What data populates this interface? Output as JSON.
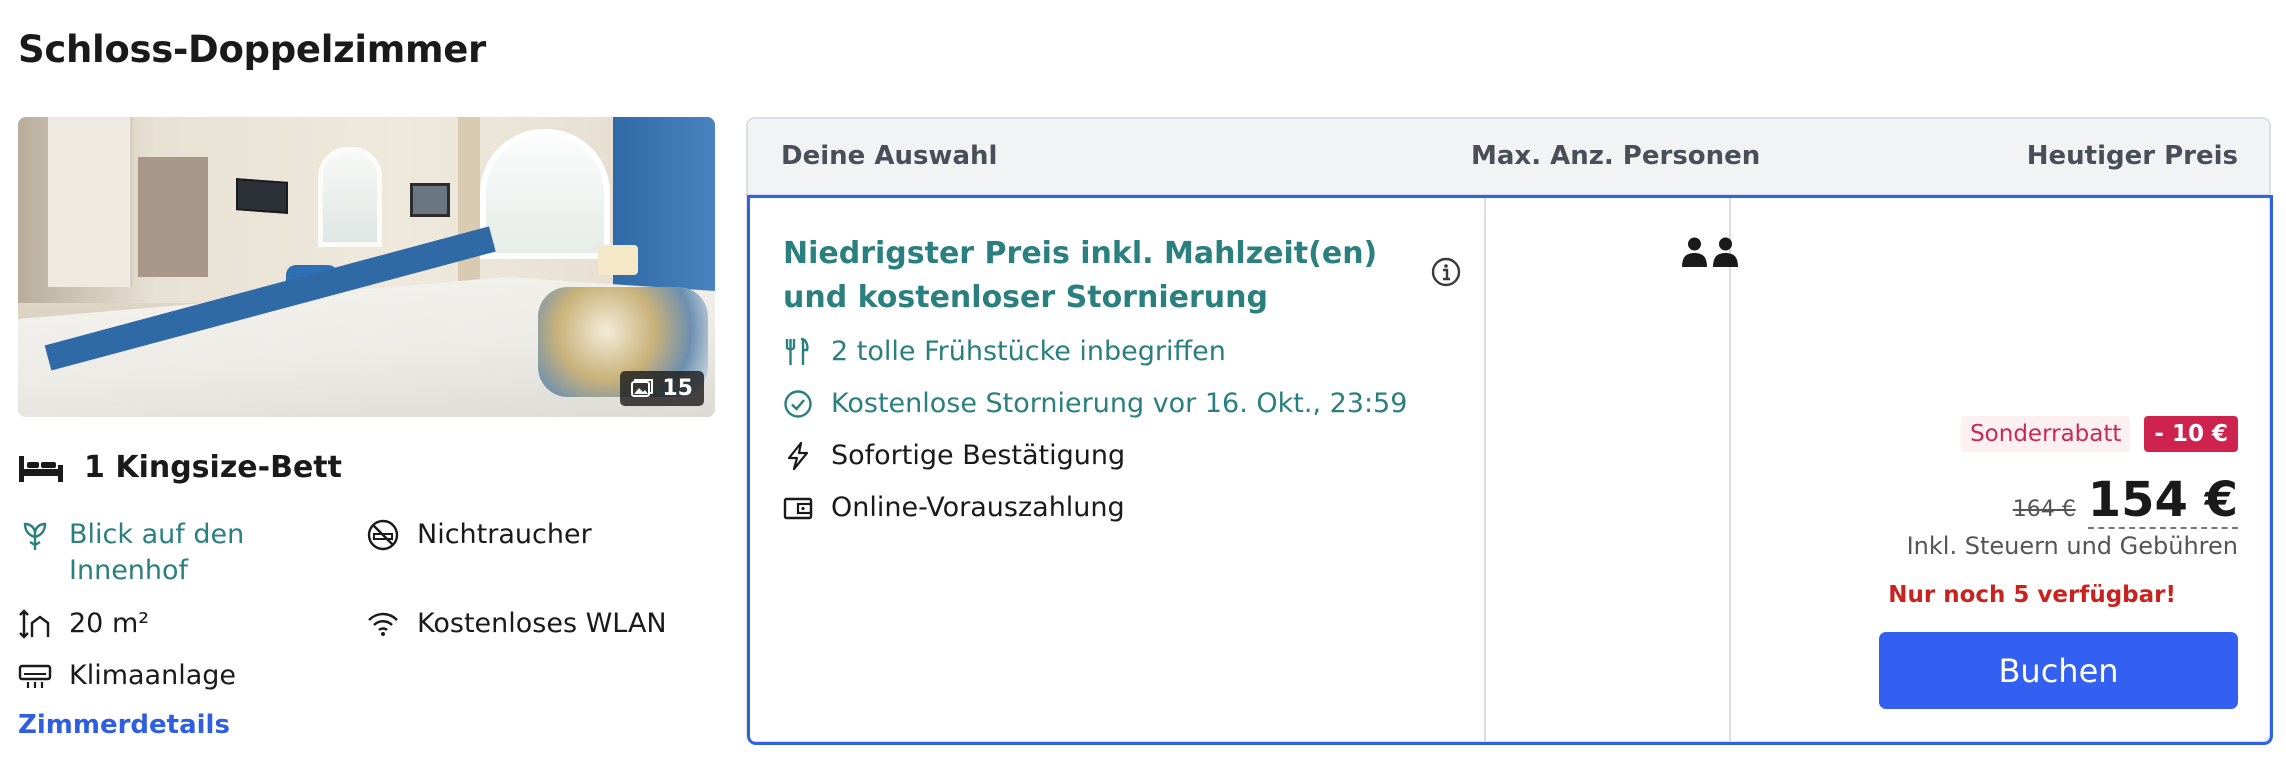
{
  "room": {
    "title": "Schloss-Doppelzimmer",
    "photo_count": "15",
    "bed": "1 Kingsize-Bett",
    "facilities": {
      "view": "Blick auf den Innenhof",
      "non_smoking": "Nichtraucher",
      "size": "20 m²",
      "wifi": "Kostenloses WLAN",
      "ac": "Klimaanlage"
    },
    "details_link": "Zimmerdetails"
  },
  "table": {
    "headers": {
      "selection": "Deine Auswahl",
      "persons": "Max. Anz. Personen",
      "price": "Heutiger Preis"
    },
    "offer": {
      "title": "Niedrigster Preis inkl. Mahlzeit(en) und kostenloser Stornierung",
      "conditions": {
        "breakfast": "2 tolle Frühstücke inbegriffen",
        "cancellation": "Kostenlose Stornierung vor 16. Okt., 23:59",
        "confirmation": "Sofortige Bestätigung",
        "payment": "Online-Vorauszahlung"
      },
      "max_persons": 2,
      "discount_label": "Sonderrabatt",
      "discount_value": "- 10 €",
      "old_price": "164 €",
      "price": "154 €",
      "tax_note": "Inkl. Steuern und Gebühren",
      "availability": "Nur noch 5 verfügbar!",
      "book_label": "Buchen"
    }
  },
  "colors": {
    "accent_teal": "#2a7f7f",
    "primary_blue": "#3360f0",
    "discount_red": "#cf234f",
    "alert_red": "#c9231f"
  }
}
